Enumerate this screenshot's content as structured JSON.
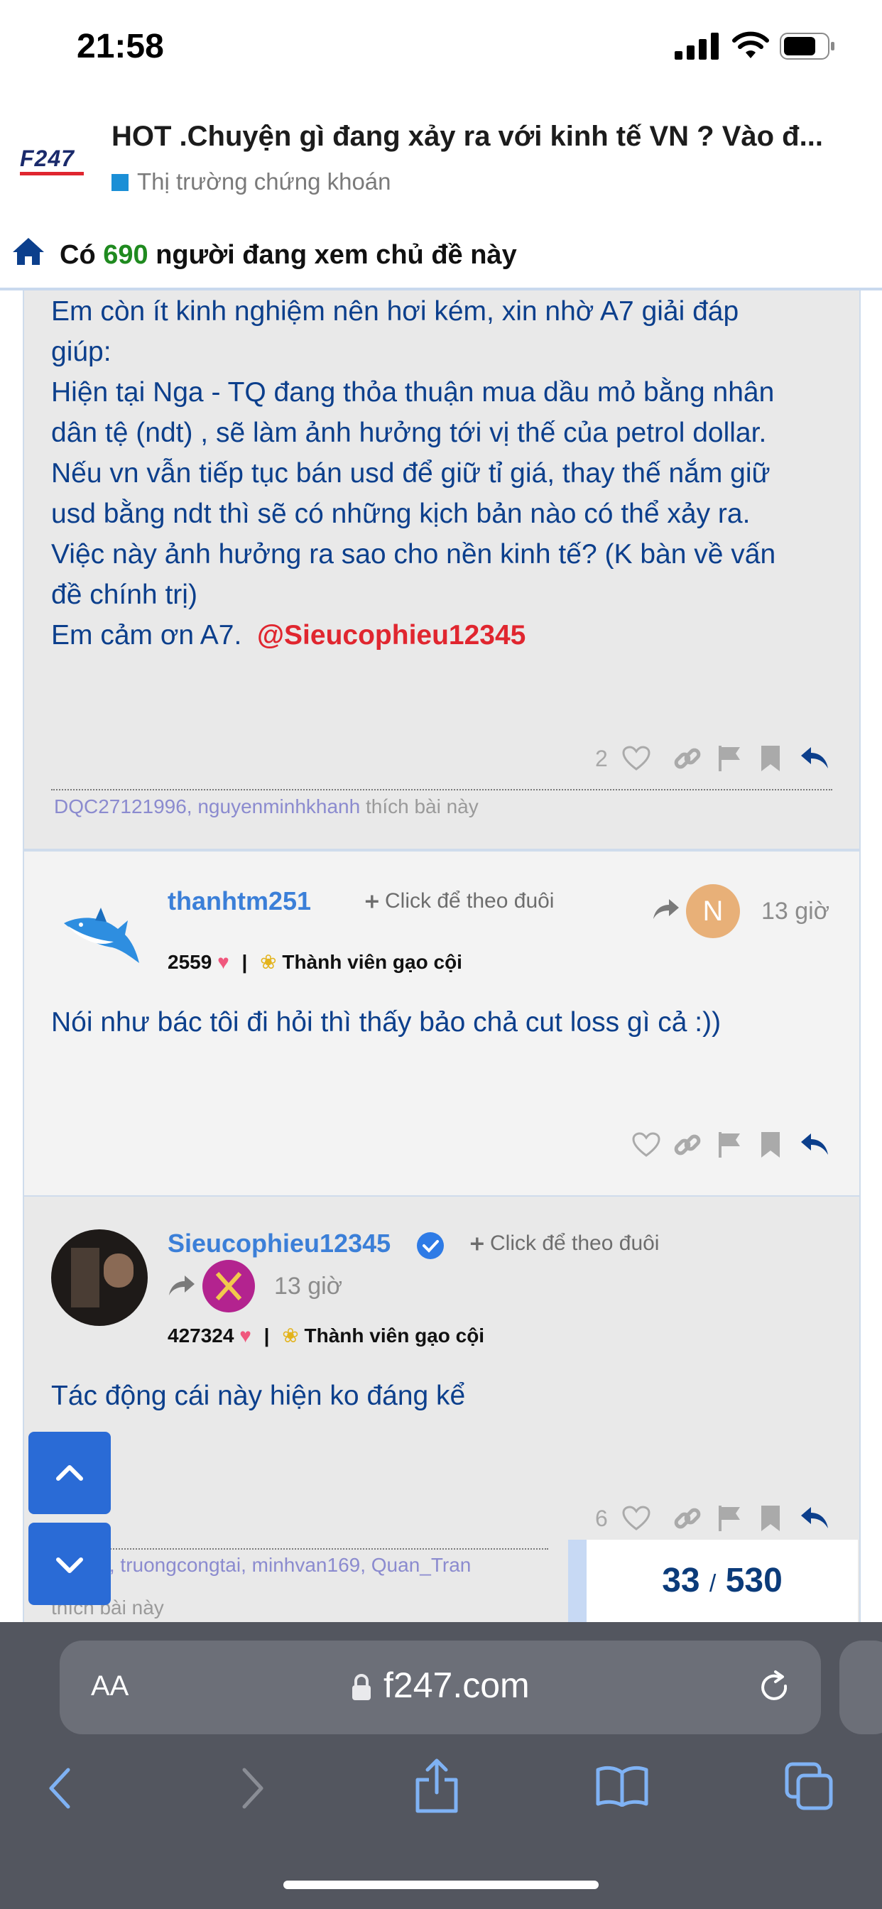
{
  "status_bar": {
    "time": "21:58"
  },
  "header": {
    "logo_text": "F247",
    "title": "HOT .Chuyện gì đang xảy ra với kinh tế VN ? Vào đ...",
    "category": "Thị trường chứng khoán"
  },
  "viewers": {
    "prefix": "Có",
    "count": "690",
    "suffix": "người đang xem chủ đề này"
  },
  "posts": [
    {
      "body_lines": [
        "Em còn ít kinh nghiệm nên hơi kém, xin nhờ A7 giải đáp",
        "giúp:",
        "Hiện tại Nga - TQ đang thỏa thuận mua dầu mỏ bằng nhân",
        "dân tệ (ndt) , sẽ làm ảnh hưởng tới vị thế của petrol dollar.",
        "Nếu vn vẫn tiếp tục bán usd để giữ tỉ giá, thay thế nắm giữ",
        "usd bằng ndt thì sẽ có những kịch bản nào có thể xảy ra.",
        "Việc này ảnh hưởng ra sao cho nền kinh tế? (K bàn về vấn",
        "đề chính trị)"
      ],
      "thanks": "Em cảm ơn A7.",
      "mention": "@Sieucophieu12345",
      "like_count": "2",
      "likers": [
        "DQC27121996,",
        "nguyenminhkhanh"
      ],
      "likers_suffix": "thích bài này"
    },
    {
      "username": "thanhtm251",
      "follow": "Click để theo đuôi",
      "reply_avatar_letter": "N",
      "time": "13 giờ",
      "score": "2559",
      "rank": "Thành viên gạo cội",
      "body": "Nói như bác tôi đi hỏi thì thấy bảo chả cut loss gì cả :))"
    },
    {
      "username": "Sieucophieu12345",
      "follow": "Click để theo đuôi",
      "time": "13 giờ",
      "score": "427324",
      "rank": "Thành viên gạo cội",
      "body": "Tác động cái này hiện ko đáng kể",
      "like_count": "6",
      "likers_text": "on_78, truongcongtai, minhvan169, Quan_Tran",
      "likers_suffix": "thích bài này"
    }
  ],
  "pagination": {
    "current": "33",
    "sep": "/",
    "total": "530"
  },
  "browser": {
    "aa": "AA",
    "url": "f247.com"
  },
  "colors": {
    "accent_blue": "#3b7fd8",
    "mention_red": "#e0262f",
    "viewer_green": "#1f8a1f",
    "body_blue": "#0c3f8c",
    "nav_button": "#2a6bd6"
  }
}
